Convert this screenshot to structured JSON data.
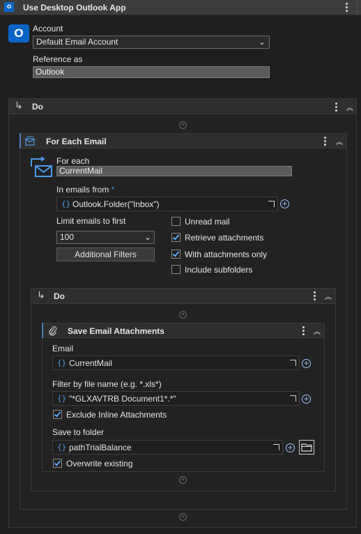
{
  "header": {
    "title": "Use Desktop Outlook App",
    "badge": "o"
  },
  "account": {
    "badge": "O",
    "label": "Account",
    "value": "Default Email Account",
    "reference_label": "Reference as",
    "reference_value": "Outlook"
  },
  "do_outer": {
    "label": "Do"
  },
  "for_each": {
    "title": "For Each Email",
    "for_each_label": "For each",
    "for_each_value": "CurrentMail",
    "in_emails_label": "In emails from",
    "required_mark": "*",
    "in_emails_value": "Outlook.Folder(\"Inbox\")",
    "limit_label": "Limit emails to first",
    "limit_value": "100",
    "filters_button": "Additional Filters",
    "options": [
      {
        "label": "Unread mail",
        "checked": false
      },
      {
        "label": "Retrieve attachments",
        "checked": true
      },
      {
        "label": "With attachments only",
        "checked": true
      },
      {
        "label": "Include subfolders",
        "checked": false
      }
    ]
  },
  "do_inner": {
    "label": "Do"
  },
  "save_attachments": {
    "title": "Save Email Attachments",
    "email_label": "Email",
    "email_value": "CurrentMail",
    "filter_label": "Filter by file name (e.g. *.xls*)",
    "filter_value": "\"*GLXAVTRB Document1*.*\"",
    "exclude_label": "Exclude Inline Attachments",
    "exclude_checked": true,
    "save_label": "Save to folder",
    "save_value": "pathTrialBalance",
    "overwrite_label": "Overwrite existing",
    "overwrite_checked": true
  },
  "icons": {
    "brace": "{}",
    "plus": "+",
    "chevron_up": "︽",
    "chevron_down": "⌄",
    "return_arrow": "↳"
  },
  "colors": {
    "accent": "#4a7fbf",
    "outlook_blue": "#0a64c8",
    "check_blue": "#5aa6ff"
  }
}
